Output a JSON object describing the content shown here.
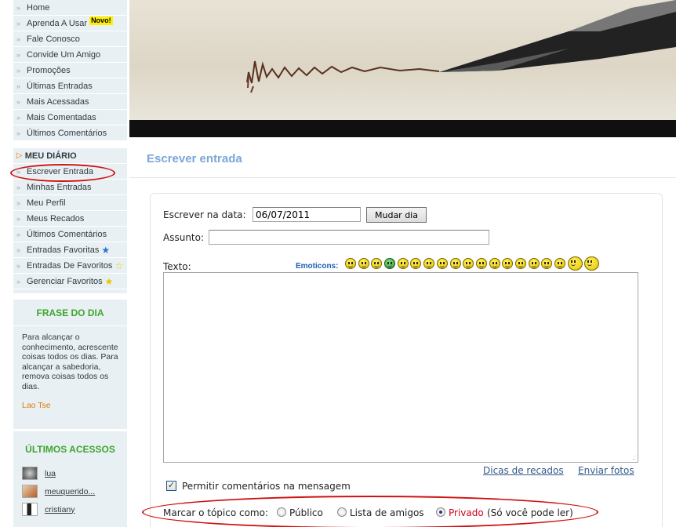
{
  "sidebar": {
    "nav": [
      {
        "label": "Home"
      },
      {
        "label": "Aprenda A Usar",
        "badge": "Novo!"
      },
      {
        "label": "Fale Conosco"
      },
      {
        "label": "Convide Um Amigo"
      },
      {
        "label": "Promoções"
      },
      {
        "label": "Últimas Entradas"
      },
      {
        "label": "Mais Acessadas"
      },
      {
        "label": "Mais Comentadas"
      },
      {
        "label": "Últimos Comentários"
      }
    ],
    "diary_title": "MEU DIÁRIO",
    "diary": [
      {
        "label": "Escrever Entrada"
      },
      {
        "label": "Minhas Entradas"
      },
      {
        "label": "Meu Perfil"
      },
      {
        "label": "Meus Recados"
      },
      {
        "label": "Últimos Comentários"
      },
      {
        "label": "Entradas Favoritas"
      },
      {
        "label": "Entradas De Favoritos"
      },
      {
        "label": "Gerenciar Favoritos"
      }
    ],
    "quote_box": {
      "title": "FRASE DO DIA",
      "text": "Para alcançar o conhecimento, acrescente coisas todos os dias. Para alcançar a sabedoria, remova coisas todos os dias.",
      "author": "Lao Tse"
    },
    "recent": {
      "title": "ÚLTIMOS ACESSOS",
      "users": [
        "lua",
        "meuquerido...",
        "cristiany"
      ]
    }
  },
  "main": {
    "title": "Escrever entrada",
    "form": {
      "date_label": "Escrever na data:",
      "date_value": "06/07/2011",
      "change_day_button": "Mudar dia",
      "subject_label": "Assunto:",
      "subject_value": "",
      "text_label": "Texto:",
      "emoticons_label": "Emoticons:",
      "emoticons": [
        "smile",
        "grin",
        "sad",
        "teeth",
        "surprised",
        "dizzy",
        "question",
        "cool",
        "happy",
        "worried",
        "laugh",
        "wink",
        "neutral",
        "angry",
        "confused",
        "tongue",
        "plain",
        "thinking",
        "thumbs-up"
      ],
      "tips_link": "Dicas de recados",
      "photos_link": "Enviar fotos",
      "allow_comments_label": "Permitir comentários na mensagem",
      "allow_comments_checked": true,
      "visibility_label": "Marcar o tópico como:",
      "visibility_options": [
        {
          "label": "Público",
          "selected": false
        },
        {
          "label": "Lista de amigos",
          "selected": false
        },
        {
          "label": "Privado",
          "selected": true
        }
      ],
      "private_hint": "(Só você pode ler)"
    }
  },
  "colors": {
    "sidebar_bg": "#e9f0f3",
    "title_blue": "#7aa6d8",
    "box_title_green": "#3ea52f",
    "author_orange": "#e07a10",
    "annotation_red": "#d01010"
  }
}
